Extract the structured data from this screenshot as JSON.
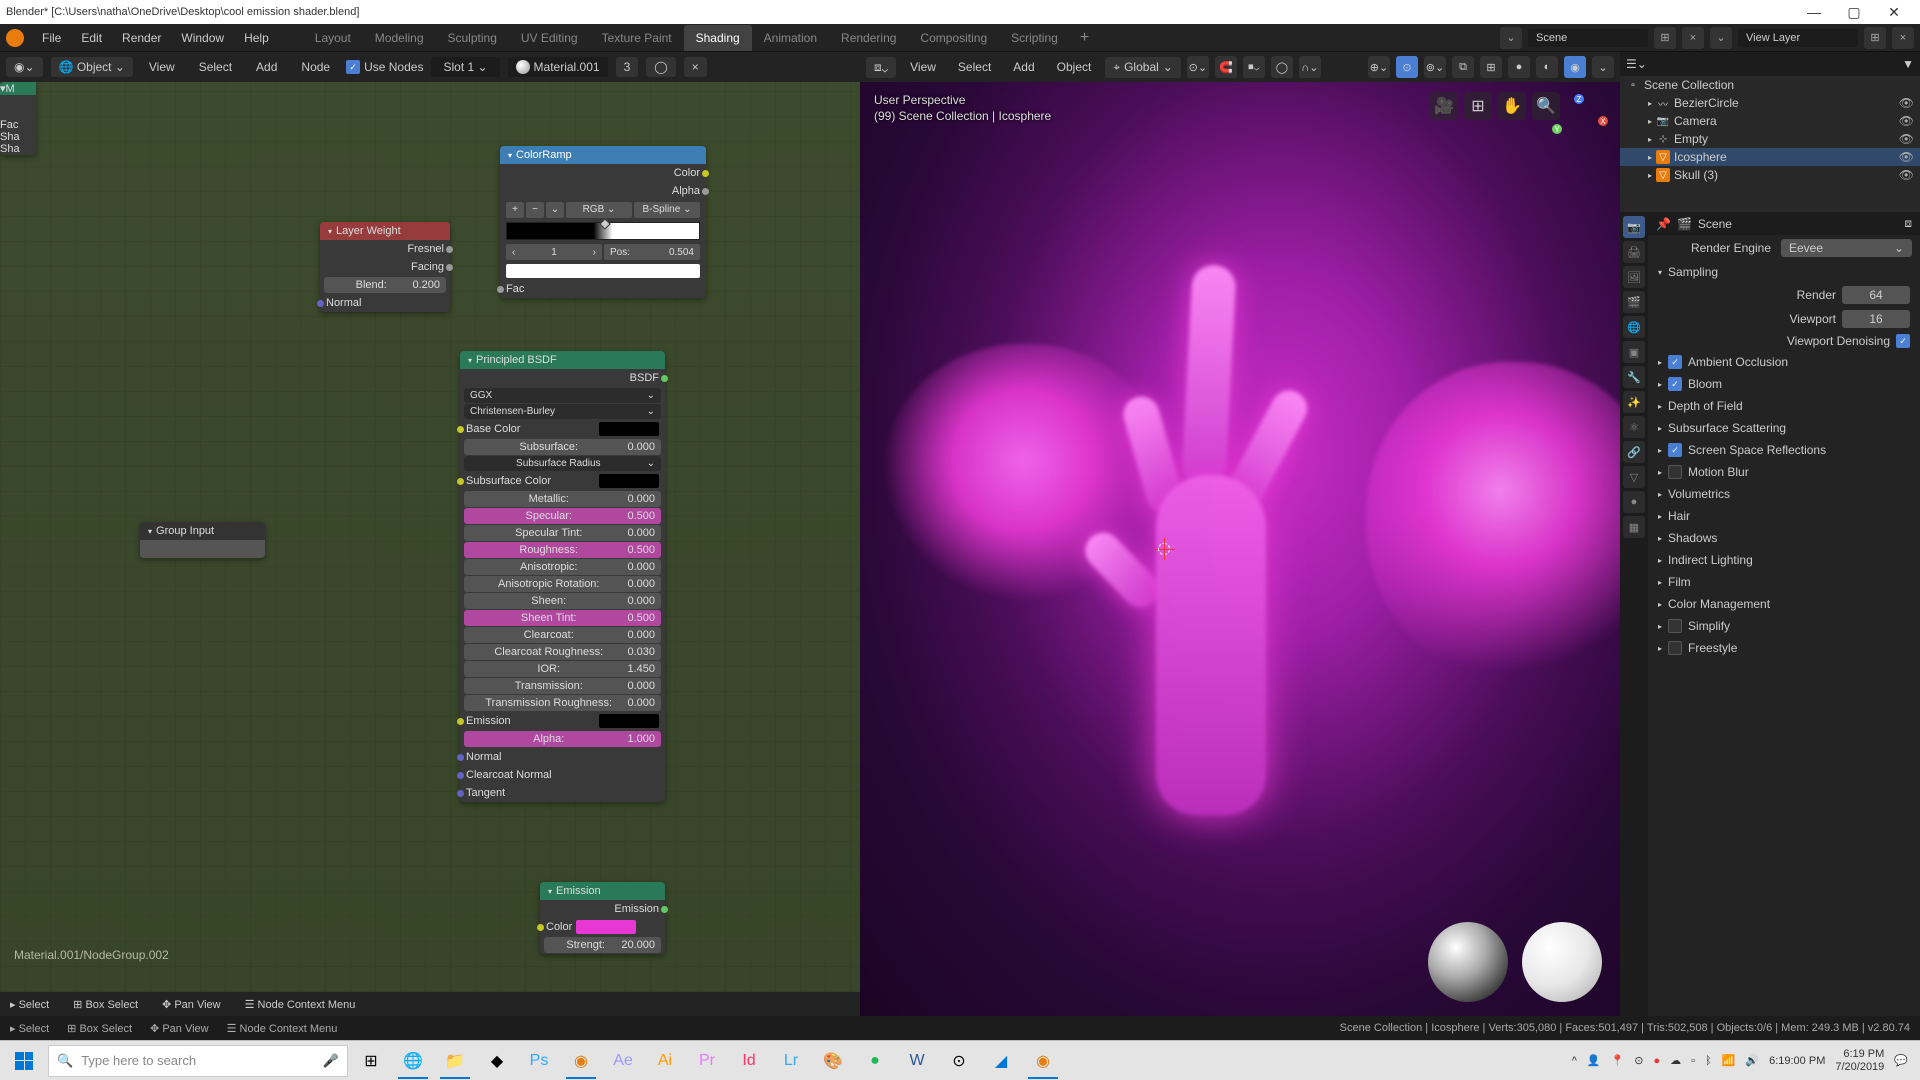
{
  "title": "Blender* [C:\\Users\\natha\\OneDrive\\Desktop\\cool emission shader.blend]",
  "menus": [
    "File",
    "Edit",
    "Render",
    "Window",
    "Help"
  ],
  "tabs": [
    "Layout",
    "Modeling",
    "Sculpting",
    "UV Editing",
    "Texture Paint",
    "Shading",
    "Animation",
    "Rendering",
    "Compositing",
    "Scripting"
  ],
  "active_tab": "Shading",
  "scene_field": "Scene",
  "view_layer_field": "View Layer",
  "node_header": {
    "mode": "Object",
    "menus": [
      "View",
      "Select",
      "Add",
      "Node"
    ],
    "use_nodes_label": "Use Nodes",
    "slot": "Slot 1",
    "material": "Material.001",
    "users": "3"
  },
  "layer_weight": {
    "title": "Layer Weight",
    "out": [
      "Fresnel",
      "Facing"
    ],
    "blend_label": "Blend:",
    "blend_val": "0.200",
    "normal": "Normal"
  },
  "group_input": {
    "title": "Group Input"
  },
  "color_ramp": {
    "title": "ColorRamp",
    "out_color": "Color",
    "out_alpha": "Alpha",
    "mode": "RGB",
    "interp": "B-Spline",
    "index": "1",
    "pos_label": "Pos:",
    "pos_val": "0.504",
    "fac": "Fac"
  },
  "principled": {
    "title": "Principled BSDF",
    "out": "BSDF",
    "distr": "GGX",
    "sss": "Christensen-Burley",
    "rows": [
      {
        "l": "Base Color",
        "swatch": "#000",
        "i": "yellow"
      },
      {
        "l": "Subsurface:",
        "v": "0.000",
        "i": "grey"
      },
      {
        "l": "Subsurface Radius",
        "i": "purple",
        "dd": true
      },
      {
        "l": "Subsurface Color",
        "swatch": "#000",
        "i": "yellow"
      },
      {
        "l": "Metallic:",
        "v": "0.000",
        "i": "grey"
      },
      {
        "l": "Specular:",
        "v": "0.500",
        "i": "grey",
        "pink": true
      },
      {
        "l": "Specular Tint:",
        "v": "0.000",
        "i": "grey"
      },
      {
        "l": "Roughness:",
        "v": "0.500",
        "i": "grey",
        "pink": true
      },
      {
        "l": "Anisotropic:",
        "v": "0.000",
        "i": "grey"
      },
      {
        "l": "Anisotropic Rotation:",
        "v": "0.000",
        "i": "grey"
      },
      {
        "l": "Sheen:",
        "v": "0.000",
        "i": "grey"
      },
      {
        "l": "Sheen Tint:",
        "v": "0.500",
        "i": "grey",
        "pink": true
      },
      {
        "l": "Clearcoat:",
        "v": "0.000",
        "i": "grey"
      },
      {
        "l": "Clearcoat Roughness:",
        "v": "0.030",
        "i": "grey"
      },
      {
        "l": "IOR:",
        "v": "1.450",
        "i": "grey"
      },
      {
        "l": "Transmission:",
        "v": "0.000",
        "i": "grey"
      },
      {
        "l": "Transmission Roughness:",
        "v": "0.000",
        "i": "grey"
      },
      {
        "l": "Emission",
        "swatch": "#000",
        "i": "yellow"
      },
      {
        "l": "Alpha:",
        "v": "1.000",
        "i": "grey",
        "pink": true
      },
      {
        "l": "Normal",
        "i": "purple"
      },
      {
        "l": "Clearcoat Normal",
        "i": "purple"
      },
      {
        "l": "Tangent",
        "i": "purple"
      }
    ]
  },
  "emission": {
    "title": "Emission",
    "out": "Emission",
    "color": "Color",
    "str_label": "Strengt:",
    "str_val": "20.000"
  },
  "mix_cut": {
    "title": "M",
    "rows": [
      "Fac",
      "Sha",
      "Sha"
    ]
  },
  "breadcrumb": "Material.001/NodeGroup.002",
  "node_footer": {
    "select": "Select",
    "box": "Box Select",
    "pan": "Pan View",
    "ctx": "Node Context Menu"
  },
  "viewport": {
    "menus": [
      "View",
      "Select",
      "Add",
      "Object"
    ],
    "orient": "Global",
    "perspective": "User Perspective",
    "info": "(99) Scene Collection | Icosphere"
  },
  "outliner": {
    "scene": "Scene Collection",
    "items": [
      {
        "name": "BezierCircle",
        "icon": "curve"
      },
      {
        "name": "Camera",
        "icon": "cam"
      },
      {
        "name": "Empty",
        "icon": "empty"
      },
      {
        "name": "Icosphere",
        "icon": "mesh",
        "sel": true
      },
      {
        "name": "Skull (3)",
        "icon": "mesh"
      }
    ]
  },
  "properties": {
    "scene_label": "Scene",
    "engine_label": "Render Engine",
    "engine": "Eevee",
    "sampling": "Sampling",
    "render_label": "Render",
    "render_val": "64",
    "viewport_label": "Viewport",
    "viewport_val": "16",
    "denoise_label": "Viewport Denoising",
    "panels": [
      {
        "name": "Ambient Occlusion",
        "checked": true
      },
      {
        "name": "Bloom",
        "checked": true
      },
      {
        "name": "Depth of Field",
        "nocb": true
      },
      {
        "name": "Subsurface Scattering",
        "nocb": true
      },
      {
        "name": "Screen Space Reflections",
        "checked": true
      },
      {
        "name": "Motion Blur",
        "checked": false
      },
      {
        "name": "Volumetrics",
        "nocb": true
      },
      {
        "name": "Hair",
        "nocb": true
      },
      {
        "name": "Shadows",
        "nocb": true
      },
      {
        "name": "Indirect Lighting",
        "nocb": true
      },
      {
        "name": "Film",
        "nocb": true
      },
      {
        "name": "Color Management",
        "nocb": true
      },
      {
        "name": "Simplify",
        "checked": false
      },
      {
        "name": "Freestyle",
        "checked": false
      }
    ]
  },
  "statusbar": {
    "select": "Select",
    "box": "Box Select",
    "pan": "Pan View",
    "ctx": "Node Context Menu",
    "info": "Scene Collection | Icosphere | Verts:305,080 | Faces:501,497 | Tris:502,508 | Objects:0/6 | Mem: 249.3 MB | v2.80.74"
  },
  "taskbar": {
    "search_placeholder": "Type here to search",
    "time": "6:19 PM",
    "date": "7/20/2019",
    "other_time": "6:19:00 PM"
  }
}
